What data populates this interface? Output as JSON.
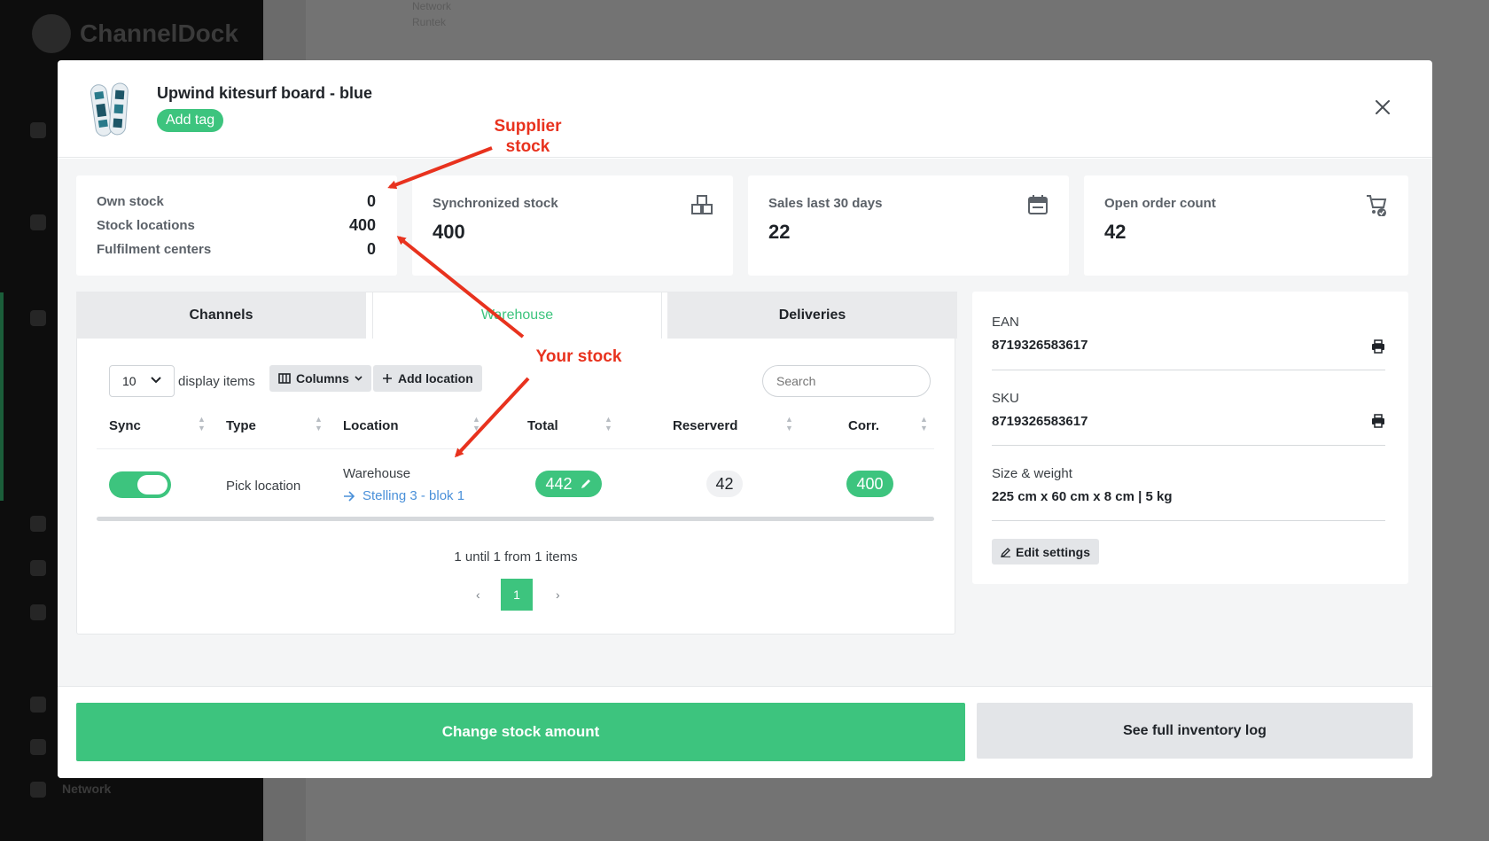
{
  "background": {
    "logo": "ChannelDock",
    "network_label": "Network",
    "text_a": "Network",
    "text_b": "Runtek"
  },
  "modal": {
    "product_title": "Upwind kitesurf board - blue",
    "add_tag_label": "Add tag",
    "close_icon": "close-icon",
    "own_stock": {
      "rows": [
        {
          "label": "Own stock",
          "value": "0"
        },
        {
          "label": "Stock locations",
          "value": "400"
        },
        {
          "label": "Fulfilment centers",
          "value": "0"
        }
      ]
    },
    "stats": [
      {
        "label": "Synchronized stock",
        "value": "400",
        "icon": "boxes-icon"
      },
      {
        "label": "Sales last 30 days",
        "value": "22",
        "icon": "calendar-icon"
      },
      {
        "label": "Open order count",
        "value": "42",
        "icon": "cart-check-icon"
      }
    ],
    "tabs": [
      {
        "label": "Channels",
        "active": false
      },
      {
        "label": "Warehouse",
        "active": true
      },
      {
        "label": "Deliveries",
        "active": false
      }
    ],
    "table_controls": {
      "page_size": "10",
      "display_items_label": "display items",
      "columns_label": "Columns",
      "add_location_label": "Add location",
      "search_placeholder": "Search"
    },
    "table": {
      "headers": [
        "Sync",
        "Type",
        "Location",
        "Total",
        "Reserverd",
        "Corr."
      ],
      "rows": [
        {
          "sync": true,
          "type": "Pick location",
          "location_name": "Warehouse",
          "location_link": "Stelling 3 - blok 1",
          "total": "442",
          "reserved": "42",
          "corr": "400"
        }
      ]
    },
    "pagination": {
      "summary": "1 until 1 from 1 items",
      "prev": "‹",
      "next": "›",
      "current_page": "1"
    },
    "info": {
      "ean_label": "EAN",
      "ean_value": "8719326583617",
      "sku_label": "SKU",
      "sku_value": "8719326583617",
      "size_label": "Size & weight",
      "size_value": "225 cm x 60 cm x 8 cm | 5 kg",
      "edit_settings_label": "Edit settings"
    },
    "footer": {
      "change_stock_label": "Change stock amount",
      "inventory_log_label": "See full inventory log"
    }
  },
  "annotations": {
    "supplier_stock_line1": "Supplier",
    "supplier_stock_line2": "stock",
    "your_stock": "Your stock",
    "color": "#e8321e"
  },
  "colors": {
    "accent_green": "#3dc47e",
    "link_blue": "#4a90d9",
    "overlay_gray": "#6b6b6b"
  }
}
